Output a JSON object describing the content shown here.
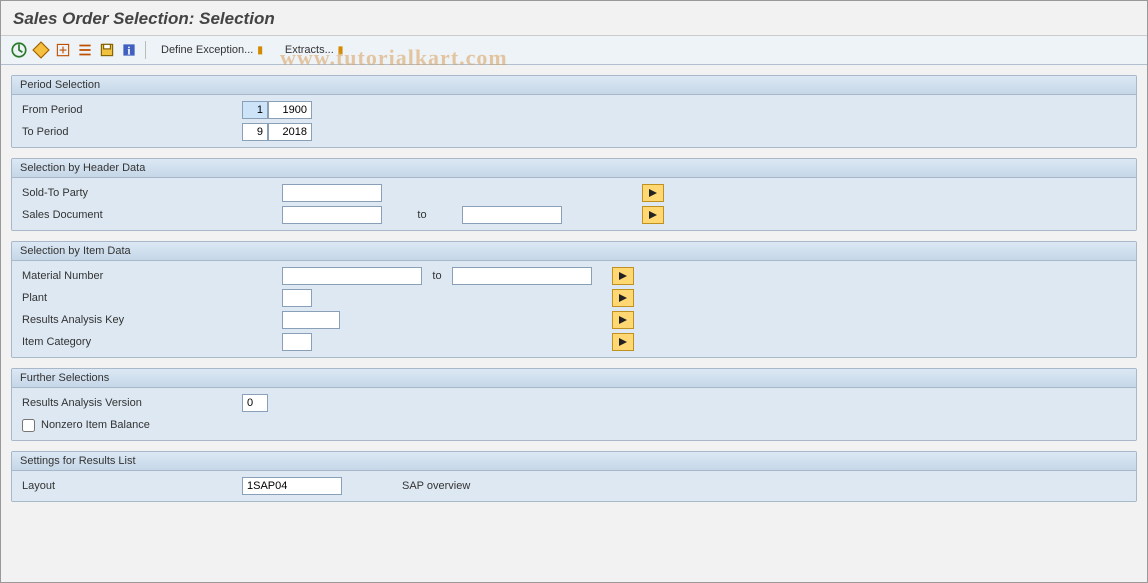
{
  "header": {
    "title": "Sales Order Selection: Selection"
  },
  "toolbar": {
    "define_exception": "Define Exception...",
    "extracts": "Extracts..."
  },
  "watermark": "www.tutorialkart.com",
  "groups": {
    "period": {
      "title": "Period Selection",
      "from_label": "From Period",
      "from_month": "1",
      "from_year": "1900",
      "to_label": "To Period",
      "to_month": "9",
      "to_year": "2018"
    },
    "header_data": {
      "title": "Selection by Header Data",
      "sold_to_label": "Sold-To Party",
      "sold_to_value": "",
      "sales_doc_label": "Sales Document",
      "sales_doc_from": "",
      "to_label": "to",
      "sales_doc_to": ""
    },
    "item_data": {
      "title": "Selection by Item Data",
      "material_label": "Material Number",
      "material_from": "",
      "to_label": "to",
      "material_to": "",
      "plant_label": "Plant",
      "plant_value": "",
      "ra_key_label": "Results Analysis Key",
      "ra_key_value": "",
      "item_cat_label": "Item Category",
      "item_cat_value": ""
    },
    "further": {
      "title": "Further Selections",
      "ra_version_label": "Results Analysis Version",
      "ra_version_value": "0",
      "nonzero_label": "Nonzero Item Balance",
      "nonzero_checked": false
    },
    "settings": {
      "title": "Settings for Results List",
      "layout_label": "Layout",
      "layout_value": "1SAP04",
      "layout_desc": "SAP overview"
    }
  }
}
